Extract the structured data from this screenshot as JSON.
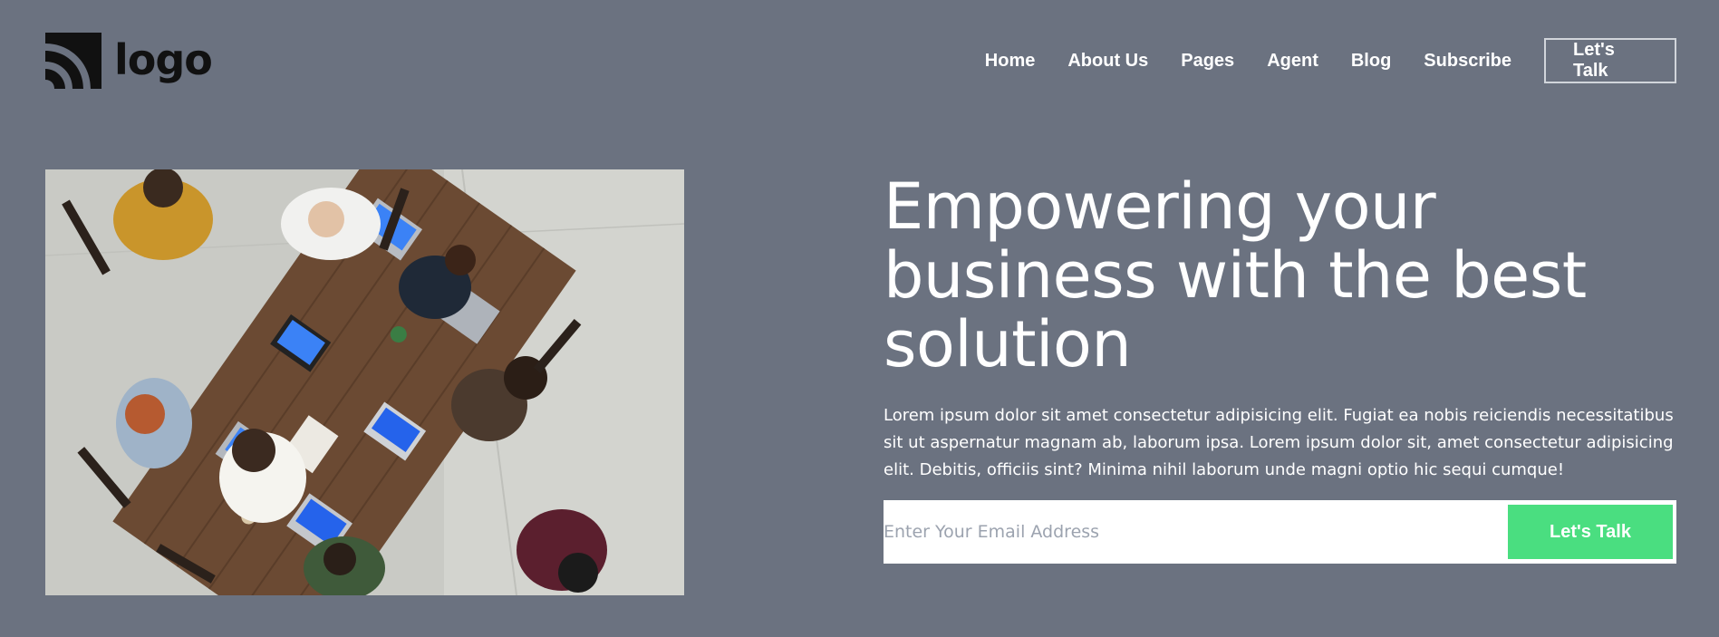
{
  "brand": {
    "logo_text": "logo"
  },
  "nav": {
    "items": [
      {
        "label": "Home"
      },
      {
        "label": "About Us"
      },
      {
        "label": "Pages"
      },
      {
        "label": "Agent"
      },
      {
        "label": "Blog"
      },
      {
        "label": "Subscribe"
      }
    ],
    "cta_label": "Let's Talk"
  },
  "hero": {
    "title": "Empowering your business with the best solution",
    "description": "Lorem ipsum dolor sit amet consectetur adipisicing elit. Fugiat ea nobis reiciendis necessitatibus sit ut aspernatur magnam ab, laborum ipsa. Lorem ipsum dolor sit, amet consectetur adipisicing elit. Debitis, officiis sint? Minima nihil laborum unde magni optio hic sequi cumque!",
    "email_placeholder": "Enter Your Email Address",
    "email_value": "",
    "button_label": "Let's Talk"
  },
  "colors": {
    "background": "#6b7280",
    "accent": "#4ade80",
    "text": "#ffffff",
    "logo": "#111111"
  },
  "icons": {
    "logo_mark": "rss-feed-icon"
  }
}
